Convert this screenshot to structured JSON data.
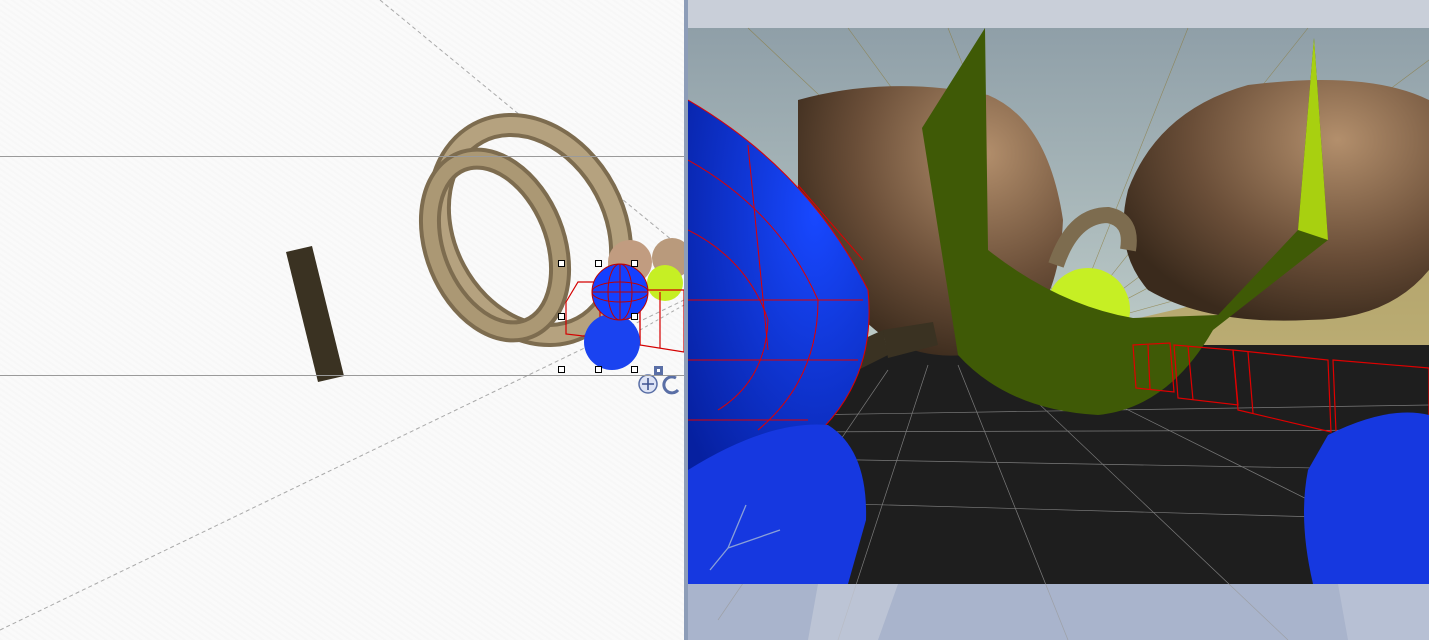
{
  "editor": {
    "left_view": {
      "kind": "wireframe-top-view",
      "background_color": "#fafafa",
      "selection_handles": 8,
      "gizmo_icons": [
        "move-gizmo-icon",
        "rotate-gizmo-icon",
        "scale-gizmo-icon"
      ]
    },
    "right_view": {
      "kind": "perspective-camera-view",
      "sky_color": "#a9b7bf",
      "floor_color": "#1e1e1e",
      "selection_wire_color": "#e00000",
      "axis_icon": "axis-triad-icon"
    },
    "colors": {
      "ring": "#b5a27f",
      "sphere_blue": "#0d3cff",
      "sphere_yellow": "#c6ef24",
      "fin_green": "#3f5a06",
      "head_brown": "#6a4e38",
      "divider": "#8d9db8"
    }
  }
}
